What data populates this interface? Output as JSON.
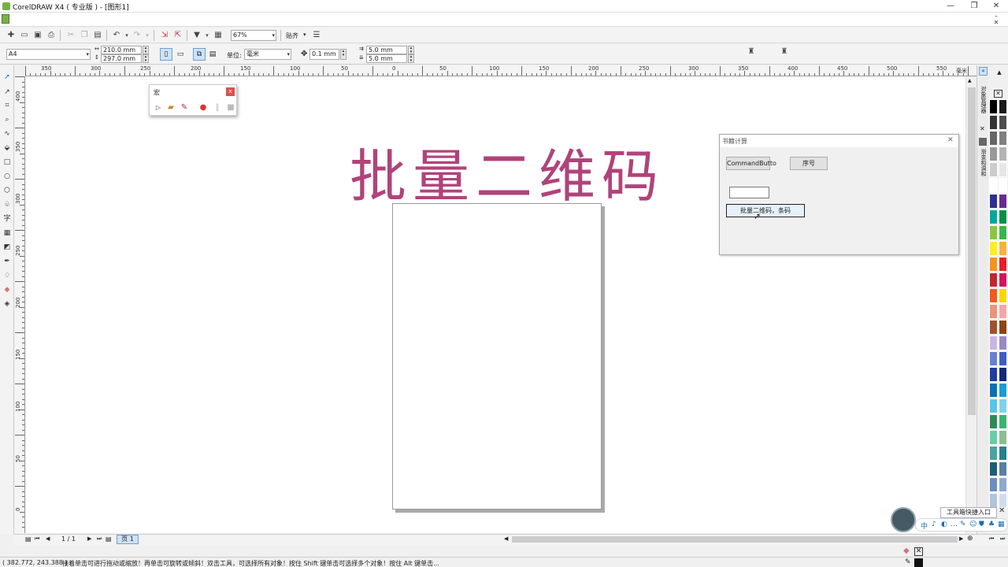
{
  "app": {
    "title": "CorelDRAW X4 ( 专业版 ) - [图形1]",
    "minimize": "—",
    "maximize": "❐",
    "close": "✕",
    "mdi_minimize": "–",
    "mdi_restore": "❐",
    "mdi_close": "✕"
  },
  "standard_toolbar": {
    "zoom_value": "67%",
    "snap_label": "贴齐",
    "snap_arrow": "▾",
    "zoom_arrow": "▾"
  },
  "property_bar": {
    "paper_size": "A4",
    "width": "210.0 mm",
    "height": "297.0 mm",
    "units_label": "单位:",
    "units_value": "毫米",
    "nudge": "0.1 mm",
    "dup_x": "5.0 mm",
    "dup_y": "5.0 mm"
  },
  "rulers": {
    "horizontal": [
      "350",
      "300",
      "250",
      "200",
      "150",
      "100",
      "50",
      "0",
      "50",
      "100",
      "150",
      "200",
      "250",
      "300",
      "350",
      "400",
      "450",
      "500",
      "550"
    ],
    "horizontal_unit": "毫米",
    "vertical": [
      "400",
      "350",
      "300",
      "250",
      "200",
      "150",
      "100",
      "50",
      "0"
    ]
  },
  "canvas": {
    "big_title": "批量二维码"
  },
  "macro_window": {
    "title": "宏",
    "close": "x"
  },
  "dialog": {
    "title": "书籍计算",
    "close": "✕",
    "command_button": "CommandButto",
    "serial_button": "序号",
    "batch_button": "批量二维码，条码",
    "text_value": ""
  },
  "docker": {
    "tab1": "对象管理器",
    "tab2": "渐变和调和"
  },
  "palette": {
    "none_swatch": "✕",
    "colors": [
      "#000000",
      "#1a1a1a",
      "#333333",
      "#4d4d4d",
      "#666666",
      "#808080",
      "#999999",
      "#b3b3b3",
      "#cccccc",
      "#e6e6e6",
      "#ffffff",
      "#ffffff",
      "#2e3192",
      "#662d91",
      "#00a99d",
      "#009245",
      "#8cc63f",
      "#39b54a",
      "#fcee21",
      "#fbb03b",
      "#f7931e",
      "#ed1c24",
      "#c1272d",
      "#d4145a",
      "#f15a24",
      "#ffd400",
      "#e9967a",
      "#f4a6a6",
      "#a0522d",
      "#8b4513",
      "#c9b6e4",
      "#9b8ac4",
      "#6a7fd0",
      "#3f5bc7",
      "#1e3d9e",
      "#12287a",
      "#0b6fb5",
      "#1b9ad6",
      "#56c5e8",
      "#7fd1f0",
      "#2e8b57",
      "#3cb371",
      "#66cdaa",
      "#8fbc8f",
      "#4aa3a0",
      "#2a7f8e",
      "#1d5f73",
      "#5a7fa0",
      "#6c8ebf",
      "#8fa9cf",
      "#b0c4de",
      "#d0dcec"
    ]
  },
  "bottom_nav": {
    "page_count": "1 / 1",
    "page_tab": "页 1"
  },
  "status": {
    "coords": "( 382.772, 243.388 )",
    "hint": "接着单击可进行拖动或缩放！再单击可旋转或倾斜！双击工具，可选择所有对象！按住 Shift 键单击可选择多个对象！按住 Alt 键单击..."
  },
  "helper": {
    "tooltip": "工具箱快捷入口",
    "ime_items": [
      "中",
      "♪",
      "◐",
      "…",
      "✎",
      "☺",
      "⛊",
      "♣",
      "▦"
    ]
  }
}
